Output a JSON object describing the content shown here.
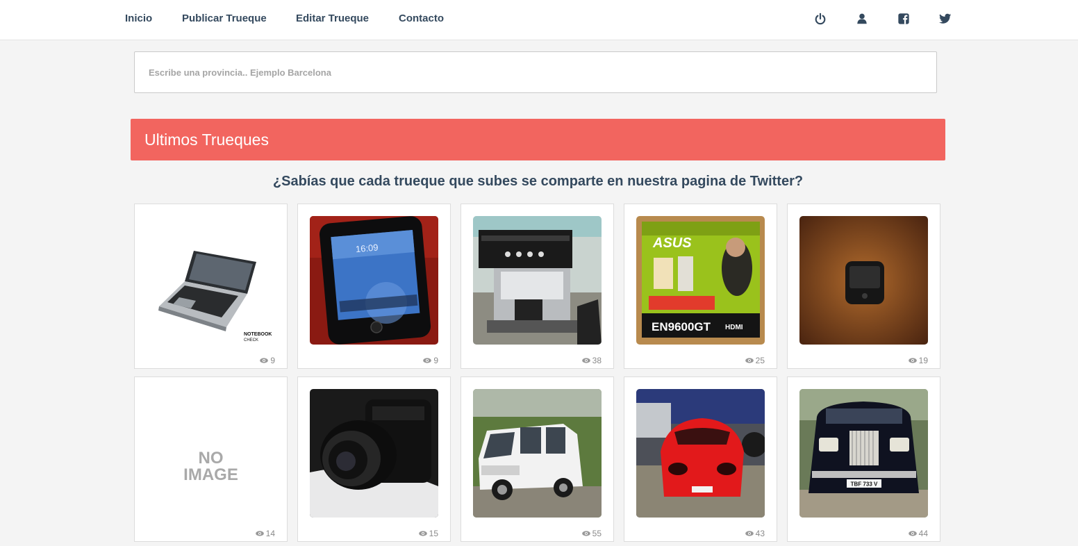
{
  "nav": {
    "links": [
      "Inicio",
      "Publicar Trueque",
      "Editar Trueque",
      "Contacto"
    ],
    "icons": [
      "power-icon",
      "user-icon",
      "facebook-icon",
      "twitter-icon"
    ]
  },
  "search": {
    "placeholder": "Escribe una provincia.. Ejemplo Barcelona"
  },
  "banner": {
    "title": "Ultimos Trueques",
    "color": "#f2655f"
  },
  "subheading": "¿Sabías que cada trueque que subes se comparte en nuestra pagina de Twitter?",
  "items": [
    {
      "image": "laptop",
      "views": "9",
      "image_text": [
        "NOTEBOOK",
        "CHECK"
      ]
    },
    {
      "image": "smartphone",
      "views": "9",
      "image_text": [
        "16:09"
      ]
    },
    {
      "image": "espresso-machine",
      "views": "38"
    },
    {
      "image": "graphics-card-box",
      "views": "25",
      "image_text": [
        "ASUS",
        "EN9600GT",
        "HDMI"
      ]
    },
    {
      "image": "pda-phone",
      "views": "19"
    },
    {
      "image": "no-image",
      "views": "14",
      "image_text": [
        "NO",
        "IMAGE"
      ]
    },
    {
      "image": "dslr-camera",
      "views": "15"
    },
    {
      "image": "white-van",
      "views": "55"
    },
    {
      "image": "red-sports-car",
      "views": "43"
    },
    {
      "image": "black-classic-car",
      "views": "44",
      "image_text": [
        "TBF 733 V"
      ]
    }
  ]
}
